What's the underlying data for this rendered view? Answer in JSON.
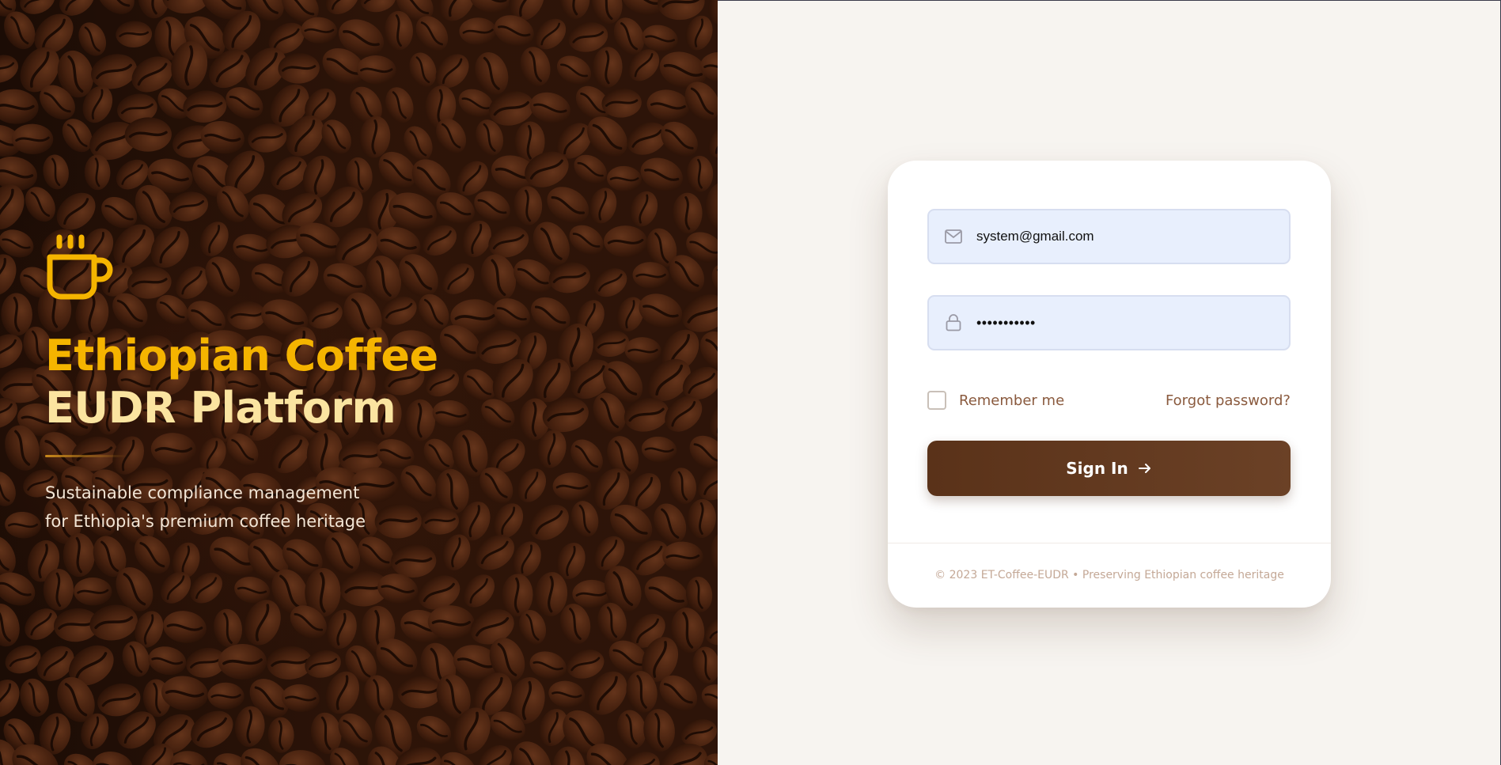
{
  "brand": {
    "title_line1": "Ethiopian Coffee",
    "title_line2": "EUDR Platform",
    "tagline_line1": "Sustainable compliance management",
    "tagline_line2": "for Ethiopia's premium coffee heritage",
    "icon": "coffee-cup-icon",
    "accent_color": "#f5b400"
  },
  "login": {
    "email_value": "system@gmail.com",
    "email_icon": "mail-icon",
    "password_value": "•••••••••••",
    "password_icon": "lock-icon",
    "remember_label": "Remember me",
    "remember_checked": false,
    "forgot_label": "Forgot password?",
    "signin_label": "Sign In",
    "signin_icon": "arrow-right-icon",
    "button_color": "#5a3219"
  },
  "footer": {
    "text": "© 2023 ET-Coffee-EUDR • Preserving Ethiopian coffee heritage"
  }
}
